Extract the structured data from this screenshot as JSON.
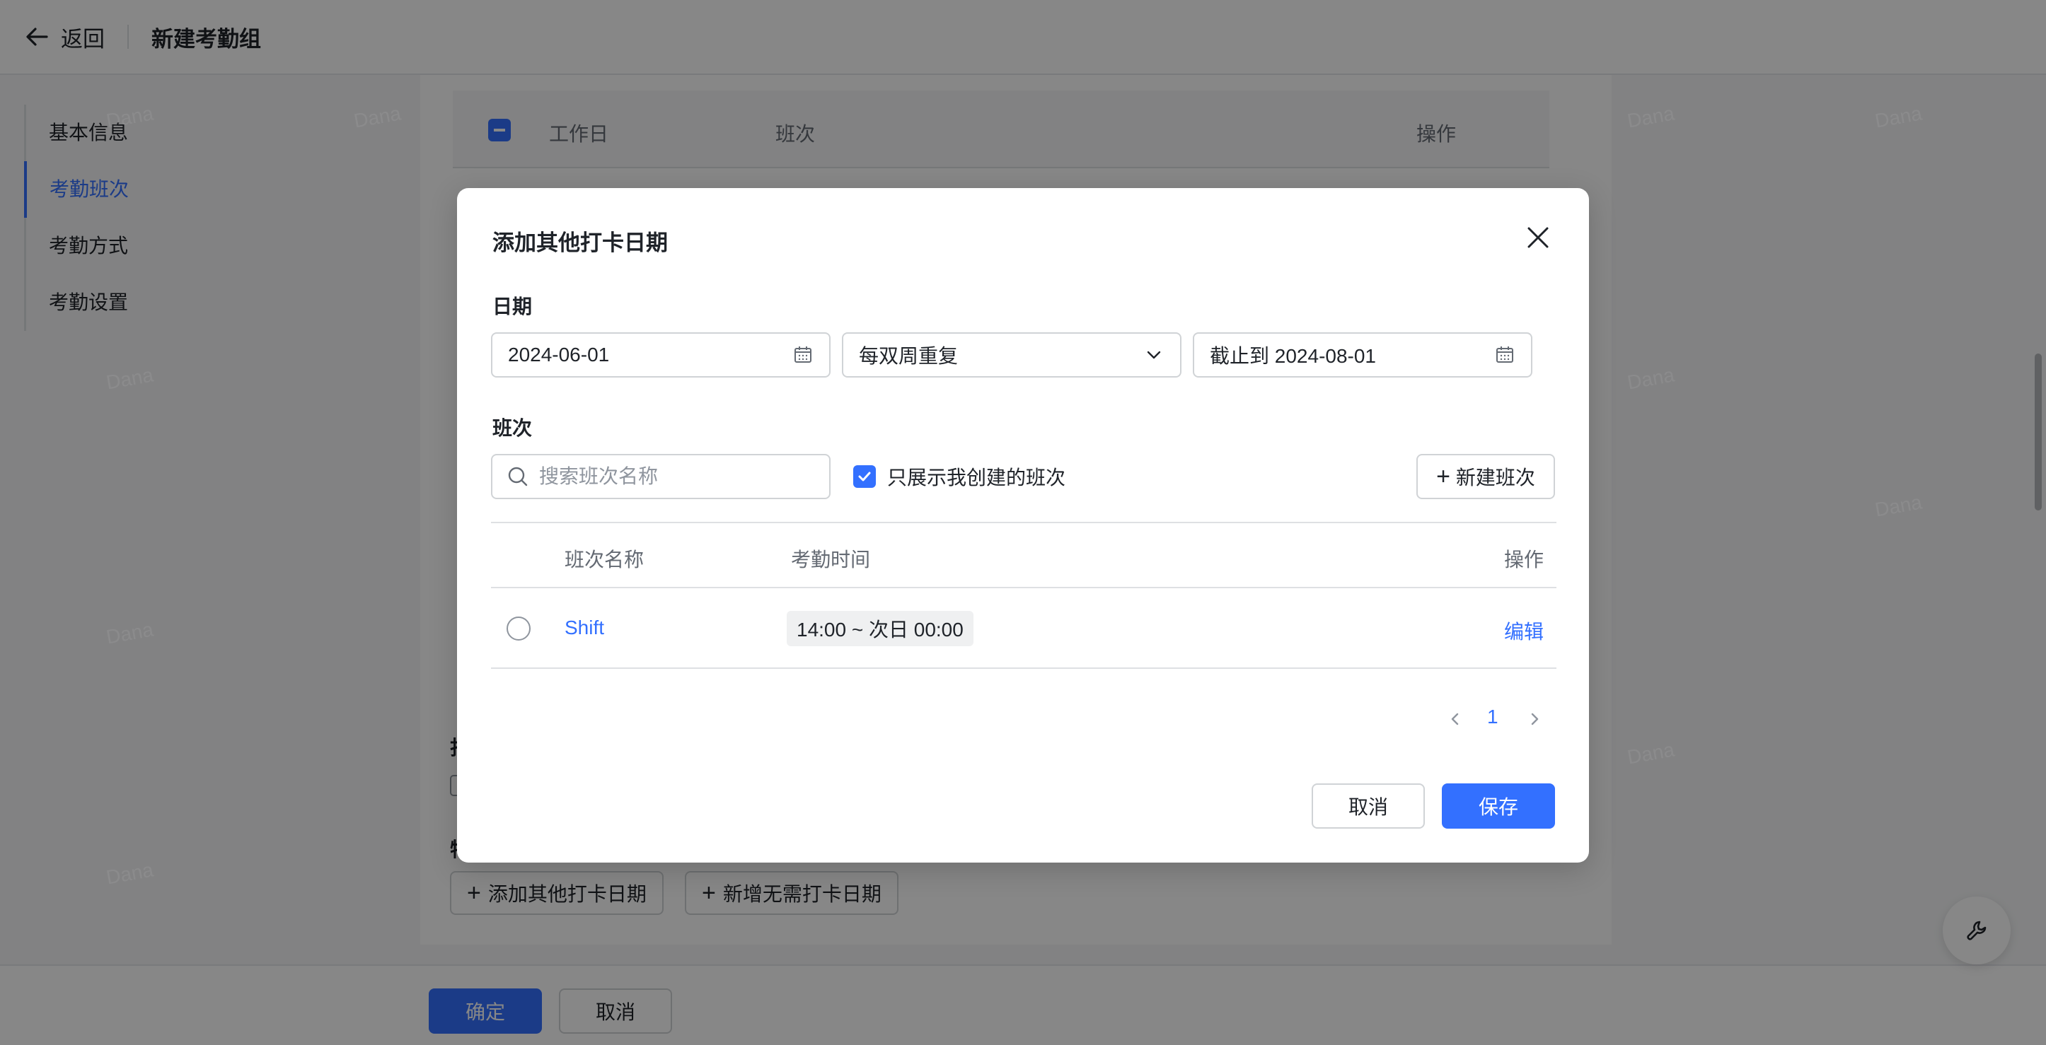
{
  "header": {
    "back_label": "返回",
    "page_title": "新建考勤组"
  },
  "sidenav": {
    "items": [
      {
        "label": "基本信息"
      },
      {
        "label": "考勤班次"
      },
      {
        "label": "考勤方式"
      },
      {
        "label": "考勤设置"
      }
    ]
  },
  "background_table": {
    "col_workday": "工作日",
    "col_shift": "班次",
    "col_actions": "操作"
  },
  "background_section": {
    "label_1": "打",
    "label_2": "特",
    "add_other_button": "添加其他打卡日期",
    "add_no_clock_button": "新增无需打卡日期"
  },
  "footer": {
    "confirm_label": "确定",
    "cancel_label": "取消"
  },
  "watermark_text": "Dana",
  "modal": {
    "title": "添加其他打卡日期",
    "date_section_label": "日期",
    "start_date": "2024-06-01",
    "repeat_option": "每双周重复",
    "end_date": "截止到 2024-08-01",
    "shift_section_label": "班次",
    "search_placeholder": "搜索班次名称",
    "only_mine_label": "只展示我创建的班次",
    "only_mine_checked": true,
    "new_shift_button": "新建班次",
    "table": {
      "col_name": "班次名称",
      "col_time": "考勤时间",
      "col_actions": "操作",
      "rows": [
        {
          "name": "Shift",
          "time": "14:00 ~ 次日 00:00",
          "action": "编辑"
        }
      ]
    },
    "pagination": {
      "current_page": "1"
    },
    "cancel_button": "取消",
    "save_button": "保存"
  },
  "colors": {
    "accent": "#3370ff",
    "mask": "rgba(0,0,0,0.47)"
  }
}
